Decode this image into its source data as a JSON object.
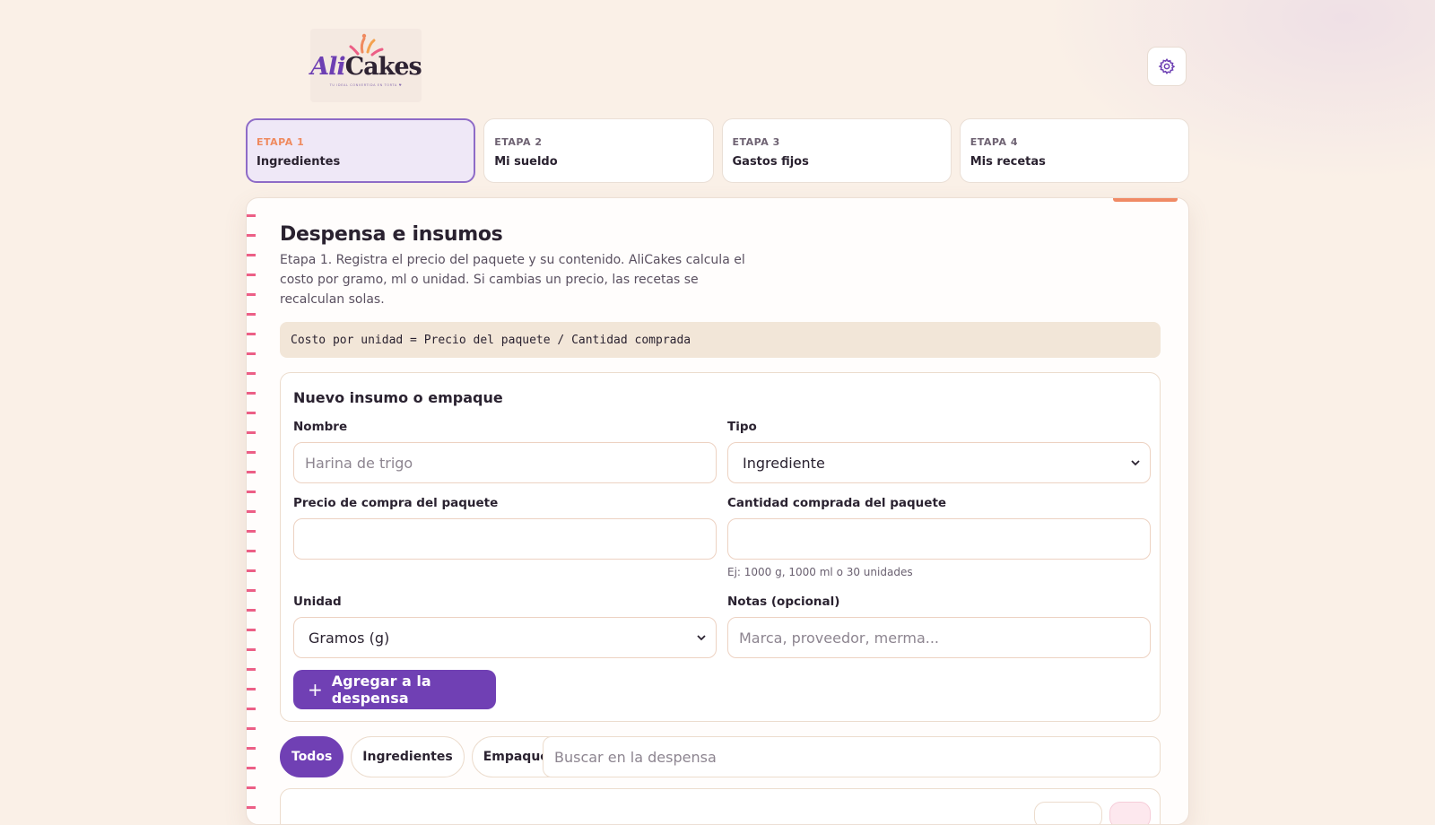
{
  "brand": {
    "logo_text_1": "Ali",
    "logo_text_2": "Cakes",
    "tagline": "TU IDEAL CONVERTIDA EN TORTA ♥",
    "colors": {
      "purple": "#7040b4",
      "orange": "#ef8a5f",
      "pink": "#ec5f86"
    }
  },
  "header": {
    "settings_icon": "gear-icon"
  },
  "steps": [
    {
      "kicker": "ETAPA 1",
      "title": "Ingredientes",
      "active": true
    },
    {
      "kicker": "ETAPA 2",
      "title": "Mi sueldo",
      "active": false
    },
    {
      "kicker": "ETAPA 3",
      "title": "Gastos fijos",
      "active": false
    },
    {
      "kicker": "ETAPA 4",
      "title": "Mis recetas",
      "active": false
    }
  ],
  "section": {
    "title": "Despensa e insumos",
    "description": "Etapa 1. Registra el precio del paquete y su contenido. AliCakes calcula el costo por gramo, ml o unidad. Si cambias un precio, las recetas se recalculan solas.",
    "formula": "Costo por unidad = Precio del paquete / Cantidad comprada"
  },
  "form": {
    "title": "Nuevo insumo o empaque",
    "name": {
      "label": "Nombre",
      "placeholder": "Harina de trigo",
      "value": ""
    },
    "type": {
      "label": "Tipo",
      "value": "Ingrediente"
    },
    "price": {
      "label": "Precio de compra del paquete",
      "value": ""
    },
    "quantity": {
      "label": "Cantidad comprada del paquete",
      "value": "",
      "hint": "Ej: 1000 g, 1000 ml o 30 unidades"
    },
    "unit": {
      "label": "Unidad",
      "value": "Gramos (g)"
    },
    "notes": {
      "label": "Notas (opcional)",
      "placeholder": "Marca, proveedor, merma...",
      "value": ""
    },
    "submit_label": "Agregar a la despensa"
  },
  "filters": {
    "chips": [
      {
        "label": "Todos",
        "active": true
      },
      {
        "label": "Ingredientes",
        "active": false
      },
      {
        "label": "Empaques",
        "active": false
      }
    ],
    "search_placeholder": "Buscar en la despensa"
  }
}
